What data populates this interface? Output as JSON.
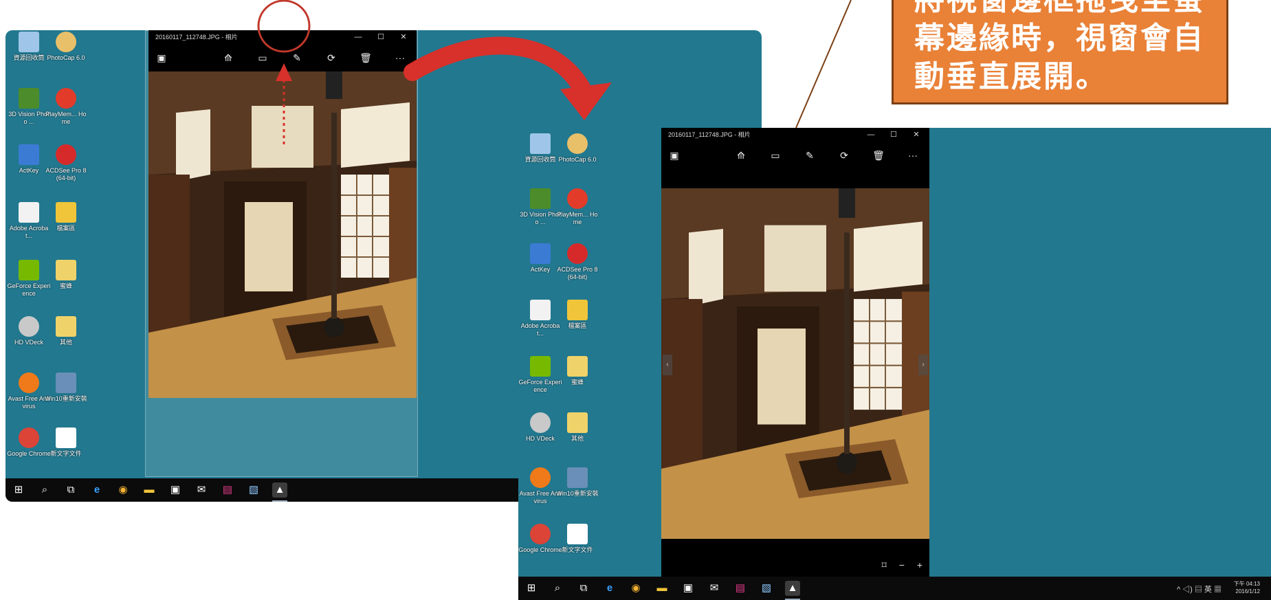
{
  "callout": {
    "text": "將視窗邊框拖曳至螢幕邊緣時，視窗會自動垂直展開。"
  },
  "photos_window": {
    "title": "20160117_112748.JPG - 相片",
    "controls": {
      "minimize": "—",
      "maximize": "☐",
      "close": "✕"
    },
    "toolbar_icons": [
      "picture-icon",
      "enhance-icon",
      "slideshow-icon",
      "edit-pencil-icon",
      "rotate-icon",
      "delete-icon",
      "more-icon"
    ],
    "more_label": "···",
    "zoom": {
      "fit": "⌑",
      "zoom_out": "−",
      "zoom_in": "+"
    }
  },
  "desktop_icons": [
    {
      "label": "資源回收筒",
      "icon": "recycle-bin-icon",
      "color": "#9fc6e8"
    },
    {
      "label": "PhotoCap 6.0",
      "icon": "photocap-icon",
      "color": "#e8c06a"
    },
    {
      "label": "3D Vision Photo ...",
      "icon": "3d-vision-icon",
      "color": "#4c8c2a"
    },
    {
      "label": "PlayMem... Home",
      "icon": "playmemories-icon",
      "color": "#e23b2a"
    },
    {
      "label": "ActKey",
      "icon": "actkey-icon",
      "color": "#3b7bd4"
    },
    {
      "label": "ACDSee Pro 8 (64-bit)",
      "icon": "acdsee-icon",
      "color": "#d62a2a"
    },
    {
      "label": "Adobe Acrobat...",
      "icon": "adobe-acrobat-icon",
      "color": "#f2f2f2"
    },
    {
      "label": "檔案區",
      "icon": "folder-icon",
      "color": "#f0c53a"
    },
    {
      "label": "GeForce Experience",
      "icon": "geforce-icon",
      "color": "#76b900"
    },
    {
      "label": "蜜蜂",
      "icon": "zip-folder-icon",
      "color": "#f0d26a"
    },
    {
      "label": "HD VDeck",
      "icon": "hdvdeck-icon",
      "color": "#c9c9c9"
    },
    {
      "label": "其他",
      "icon": "zip-folder-icon",
      "color": "#f0d26a"
    },
    {
      "label": "Avast Free Antivirus",
      "icon": "avast-icon",
      "color": "#f07a1a"
    },
    {
      "label": "Win10重新安裝",
      "icon": "monitor-icon",
      "color": "#6a8fb8"
    },
    {
      "label": "Google Chrome",
      "icon": "chrome-icon",
      "color": "#db4437"
    },
    {
      "label": "新文字文件",
      "icon": "text-document-icon",
      "color": "#ffffff"
    }
  ],
  "taskbar": {
    "items": [
      {
        "name": "start-button",
        "icon": "windows-icon",
        "glyph": "⊞"
      },
      {
        "name": "search-button",
        "icon": "search-icon",
        "glyph": "⌕"
      },
      {
        "name": "task-view-button",
        "icon": "task-view-icon",
        "glyph": "⧉"
      },
      {
        "name": "edge-button",
        "icon": "edge-icon",
        "glyph": "e"
      },
      {
        "name": "chrome-button",
        "icon": "chrome-icon",
        "glyph": "◉"
      },
      {
        "name": "file-explorer-button",
        "icon": "folder-icon",
        "glyph": "▬"
      },
      {
        "name": "store-button",
        "icon": "store-icon",
        "glyph": "▣"
      },
      {
        "name": "mail-button",
        "icon": "mail-icon",
        "glyph": "✉"
      },
      {
        "name": "app-button",
        "icon": "app-icon",
        "glyph": "▤"
      },
      {
        "name": "photo-app-button",
        "icon": "image-icon",
        "glyph": "▧"
      },
      {
        "name": "photos-button",
        "icon": "photos-icon",
        "glyph": "▲"
      }
    ],
    "tray": {
      "icons": "^ ◁) ▤ 英 ▦",
      "time": "下午 04:13",
      "date": "2016/1/12"
    }
  },
  "colors": {
    "desktop": "#22788f",
    "callout_bg": "#e98137",
    "arrow": "#d8302a",
    "highlight_circle": "#c0392b"
  }
}
